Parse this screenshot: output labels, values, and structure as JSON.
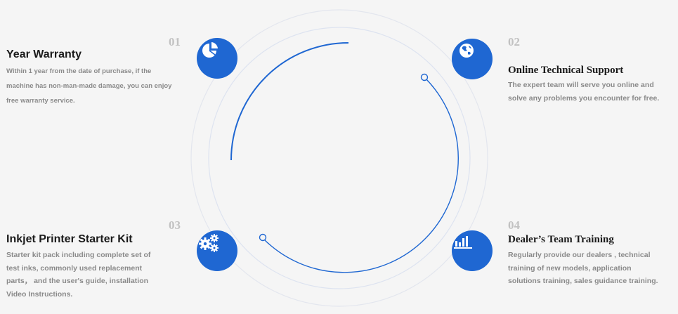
{
  "features": [
    {
      "number": "01",
      "title": "Year Warranty",
      "description_lines": [
        "Within 1 year from the date of purchase, if the",
        "machine has non-man-made damage, you can enjoy",
        "free warranty service."
      ],
      "icon": "pie-chart-icon"
    },
    {
      "number": "02",
      "title": "Online Technical Support",
      "description_lines": [
        "The expert team will serve you online and",
        "solve any problems you encounter for free."
      ],
      "icon": "globe-icon"
    },
    {
      "number": "03",
      "title": "Inkjet Printer Starter Kit",
      "description_lines": [
        "Starter kit pack including complete set of",
        "test inks, commonly used replacement",
        "parts， and the user's guide, installation",
        "Video Instructions."
      ],
      "icon": "gears-icon"
    },
    {
      "number": "04",
      "title": "Dealer’s Team Training",
      "description_lines": [
        "Regularly provide our dealers , technical",
        "training of new models, application",
        "solutions training, sales guidance training."
      ],
      "icon": "bar-chart-icon"
    }
  ],
  "colors": {
    "accent": "#1f67d2",
    "background": "#f5f5f5",
    "number": "#c2c2c2",
    "title": "#1a1a1a",
    "text": "#8a8a8a"
  }
}
